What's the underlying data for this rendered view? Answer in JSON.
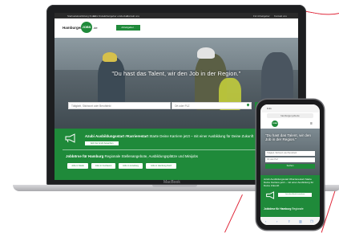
{
  "laptop": {
    "brand_label": "MacBook",
    "topbar_links": [
      "Startseite",
      "Ausbildung finden",
      "Jobs finden",
      "Arbeitgeber entdecken",
      "Kontakt uns"
    ],
    "topbar_right": [
      "Für Arbeitgeber",
      "Kontakt uns"
    ],
    "logo": {
      "prefix": "Hamburger",
      "badge": "JOBS",
      "suffix": ".de"
    },
    "header_button": "Arbeitgeber · Anmelden",
    "hero": {
      "quote": "\"Du hast das Talent, wir den Job in der Region.\"",
      "search_placeholder": "Tätigkeit, Stichwort oder Berufsfeld",
      "place_placeholder": "Ort oder PLZ",
      "search_button": "Suchen"
    },
    "azubi": {
      "title": "Azubi Ausbildungsstart #Karrierestart",
      "text": " Starte Deine Karriere jetzt – mit einer Ausbildung für Deine Zukunft",
      "button": "Jetzt bei Azubi bewerben"
    },
    "jobs": {
      "title": "Jobbörse für Hamburg",
      "text": " Regionale Stellenangebote, Ausbildungsplätze und Minijobs",
      "chips": [
        "Jobs in Stade",
        "Jobs in Cuxhaven",
        "Jobs in Lüneburg",
        "Jobs in Hamburg Nord"
      ]
    }
  },
  "phone": {
    "status_time": "9:41",
    "url": "hamburger-jobs.de",
    "logo_badge": "JOBS",
    "quote": "\"Du hast das Talent, wir den Job in der Region.\"",
    "search_placeholder": "Tätigkeit, Stichwort oder Berufsfeld",
    "place_placeholder": "Ort oder PLZ",
    "search_button": "Suchen",
    "azubi_text": "Azubi Ausbildungsstart #Karrierestart Starte Deine Karriere jetzt – mit einer Ausbildung für Deine Zukunft",
    "azubi_button": "Jetzt bei Azubi bewerben",
    "jobs_title": "Jobbörse für Hamburg",
    "jobs_text": " Regionale"
  },
  "colors": {
    "brand_green": "#1f8a3a",
    "accent_red": "#e0283a",
    "device_dark": "#1d1e20"
  }
}
